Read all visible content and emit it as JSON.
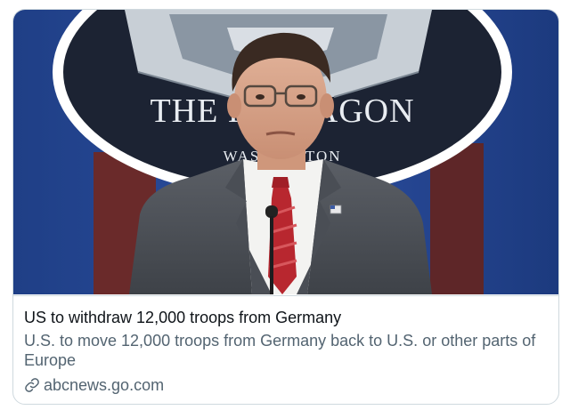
{
  "link_card": {
    "image": {
      "seal_text_top": "THE PENTAGON",
      "seal_text_bottom": "WASHINGTON"
    },
    "title": "US to withdraw 12,000 troops from Germany",
    "description": "U.S. to move 12,000 troops from Germany back to U.S. or other parts of Europe",
    "domain": "abcnews.go.com",
    "domain_icon": "link-icon"
  }
}
